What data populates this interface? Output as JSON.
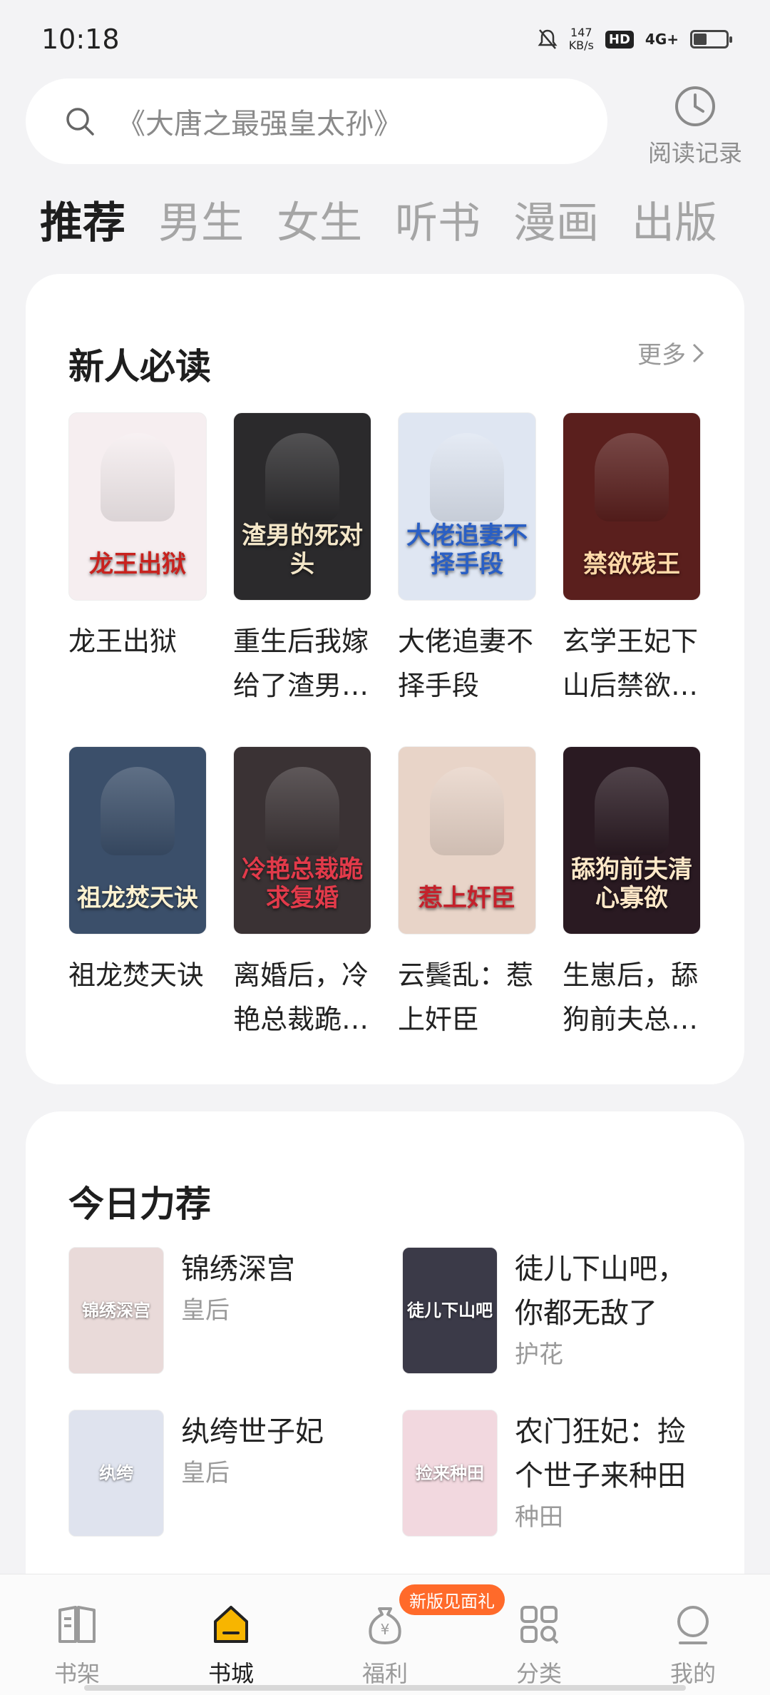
{
  "status": {
    "time": "10:18",
    "net_speed_value": "147",
    "net_speed_unit": "KB/s",
    "hd": "HD",
    "signal": "4G+",
    "battery_level": 0.4
  },
  "search": {
    "placeholder": "《大唐之最强皇太孙》"
  },
  "history": {
    "label": "阅读记录"
  },
  "tabs": [
    "推荐",
    "男生",
    "女生",
    "听书",
    "漫画",
    "出版"
  ],
  "section_new": {
    "title": "新人必读",
    "more": "更多",
    "books": [
      {
        "name": "龙王出狱",
        "cover_text": "龙王出狱",
        "cover_color": "#f6eef0",
        "title_color": "#c8221e"
      },
      {
        "name": "重生后我嫁给了渣男的死对头",
        "cover_text": "渣男的死对头",
        "cover_color": "#2b2a2c",
        "title_color": "#f3e6c8"
      },
      {
        "name": "大佬追妻不择手段",
        "cover_text": "大佬追妻不择手段",
        "cover_color": "#dfe6f2",
        "title_color": "#2a5fc4"
      },
      {
        "name": "玄学王妃下山后禁欲残王宠上瘾",
        "cover_text": "禁欲残王",
        "cover_color": "#5a1f1d",
        "title_color": "#ffd9a8"
      },
      {
        "name": "祖龙焚天诀",
        "cover_text": "祖龙焚天诀",
        "cover_color": "#3b4f6a",
        "title_color": "#fff2d0"
      },
      {
        "name": "离婚后，冷艳总裁跪求复婚",
        "cover_text": "冷艳总裁跪求复婚",
        "cover_color": "#3a3234",
        "title_color": "#e23a4a"
      },
      {
        "name": "云鬓乱：惹上奸臣",
        "cover_text": "惹上奸臣",
        "cover_color": "#e8d4c8",
        "title_color": "#c4212b"
      },
      {
        "name": "生崽后，舔狗前夫总说他清心寡欲",
        "cover_text": "舔狗前夫清心寡欲",
        "cover_color": "#2a1a22",
        "title_color": "#ffe8c8"
      }
    ]
  },
  "section_today": {
    "title": "今日力荐",
    "items": [
      {
        "title": "锦绣深宫",
        "tag": "皇后",
        "cover_text": "锦绣深宫",
        "cover_color": "#e9dad9"
      },
      {
        "title": "徒儿下山吧，你都无敌了",
        "tag": "护花",
        "cover_text": "徒儿下山吧",
        "cover_color": "#3b3a48"
      },
      {
        "title": "纨绔世子妃",
        "tag": "皇后",
        "cover_text": "纨绔",
        "cover_color": "#dfe3ee"
      },
      {
        "title": "农门狂妃：捡个世子来种田",
        "tag": "种田",
        "cover_text": "捡来种田",
        "cover_color": "#f2d8df"
      }
    ]
  },
  "bottom_nav": [
    {
      "label": "书架",
      "icon": "bookshelf-icon",
      "active": false
    },
    {
      "label": "书城",
      "icon": "bookstore-icon",
      "active": true
    },
    {
      "label": "福利",
      "icon": "money-bag-icon",
      "active": false,
      "badge": "新版见面礼"
    },
    {
      "label": "分类",
      "icon": "category-icon",
      "active": false
    },
    {
      "label": "我的",
      "icon": "profile-icon",
      "active": false
    }
  ],
  "colors": {
    "accent": "#ff6a2a",
    "active_nav_icon": "#f7b500"
  }
}
